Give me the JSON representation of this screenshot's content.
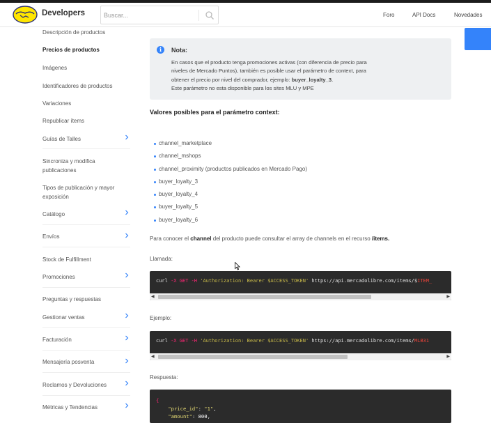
{
  "header": {
    "brand": "Developers",
    "search_placeholder": "Buscar...",
    "nav": [
      "Foro",
      "API Docs",
      "Novedades"
    ]
  },
  "sidebar": {
    "items": [
      {
        "label": "Descripción de productos",
        "chevron": false
      },
      {
        "label": "Precios de productos",
        "chevron": false,
        "active": true
      },
      {
        "label": "Imágenes",
        "chevron": false
      },
      {
        "label": "Identificadores de productos",
        "chevron": false
      },
      {
        "label": "Variaciones",
        "chevron": false
      },
      {
        "label": "Republicar ítems",
        "chevron": false
      },
      {
        "label": "Guías de Talles",
        "chevron": true
      },
      {
        "label": "Sincroniza y modifica publicaciones",
        "chevron": false
      },
      {
        "label": "Tipos de publicación y mayor exposición",
        "chevron": false
      },
      {
        "label": "Catálogo",
        "chevron": true
      },
      {
        "label": "Envíos",
        "chevron": true
      },
      {
        "label": "Stock de Fulfillment",
        "chevron": false
      },
      {
        "label": "Promociones",
        "chevron": true
      },
      {
        "label": "Preguntas y respuestas",
        "chevron": false
      },
      {
        "label": "Gestionar ventas",
        "chevron": true
      },
      {
        "label": "Facturación",
        "chevron": true
      },
      {
        "label": "Mensajería posventa",
        "chevron": true
      },
      {
        "label": "Reclamos y Devoluciones",
        "chevron": true
      },
      {
        "label": "Métricas y Tendencias",
        "chevron": true
      }
    ]
  },
  "note": {
    "title": "Nota:",
    "line1": "En casos que el producto tenga promociones activas (con diferencia de precio para",
    "line2": "niveles de Mercado Puntos), también es posible usar el parámetro de context, para",
    "line3_pre": "obtener el precio por nivel del comprador, ejemplo: ",
    "line3_bold": "buyer_loyalty_3",
    "line3_post": ".",
    "line4": "Este parámetro no esta disponible para los sites MLU y MPE"
  },
  "values_heading": "Valores posibles para el parámetro context:",
  "values": [
    "channel_marketplace",
    "channel_mshops",
    "channel_proximity (productos publicados en Mercado Pago)",
    "buyer_loyalty_3",
    "buyer_loyalty_4",
    "buyer_loyalty_5",
    "buyer_loyalty_6"
  ],
  "para": {
    "pre": "Para conocer el ",
    "bold1": "channel",
    "mid": " del producto puede consultar el array de channels en el recurso ",
    "bold2": "/items."
  },
  "llamada_label": "Llamada:",
  "llamada_code": {
    "cmd": "curl ",
    "flag1": "-X GET -H ",
    "header": "'Authorization: Bearer $ACCESS_TOKEN'",
    "url": " https://api.mercadolibre.com/items/$",
    "tail": "ITEM_"
  },
  "ejemplo_label": "Ejemplo:",
  "ejemplo_code": {
    "cmd": "curl ",
    "flag1": "-X GET -H ",
    "header": "'Authorization: Bearer $ACCESS_TOKEN'",
    "url": " https://api.mercadolibre.com/items/",
    "tail": "MLB31"
  },
  "respuesta_label": "Respuesta:",
  "response": {
    "open": "{",
    "k1": "\"price_id\"",
    "v1": "\"1\"",
    "k2": "\"amount\"",
    "v2": "800"
  }
}
